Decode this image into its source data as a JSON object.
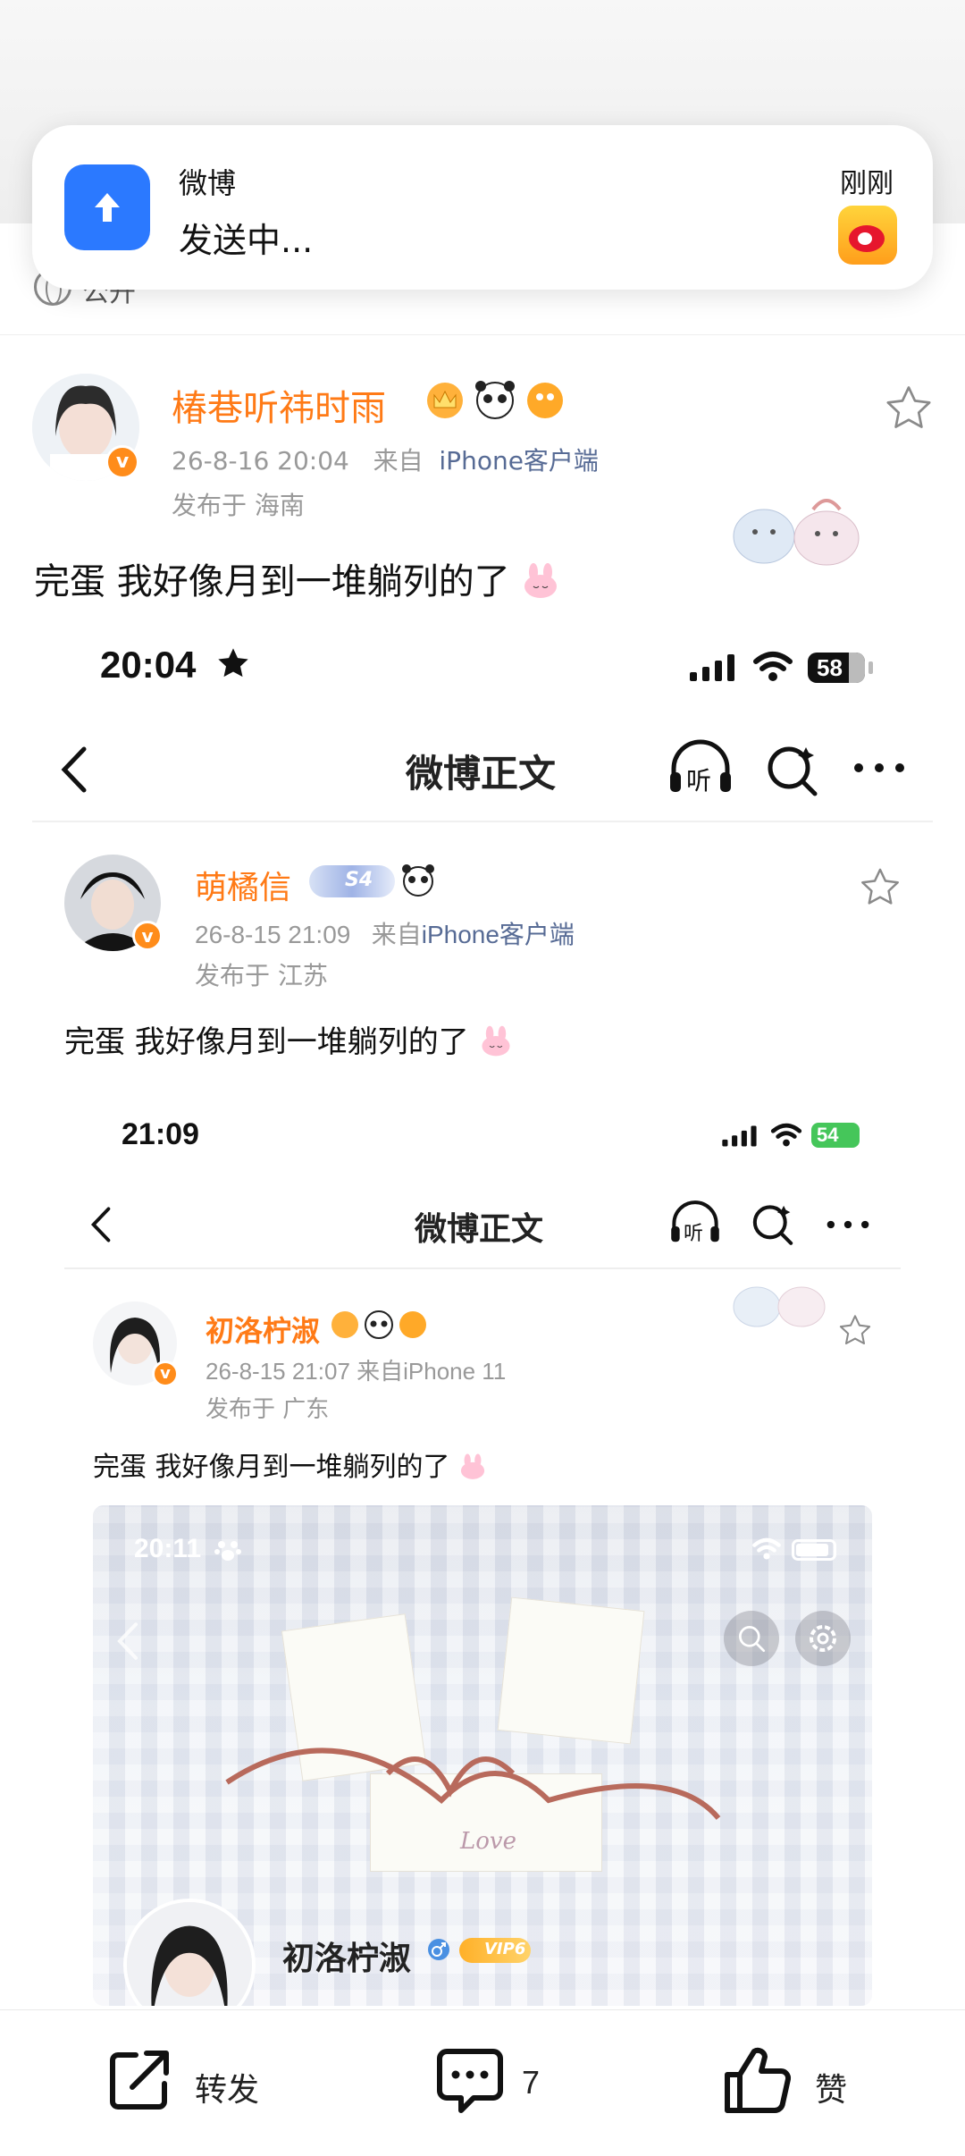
{
  "notification": {
    "app_name": "微博",
    "message": "发送中...",
    "time": "刚刚"
  },
  "visibility": {
    "label": "公开"
  },
  "post": {
    "author": "椿巷听祎时雨",
    "timestamp": "26-8-16 20:04",
    "source_prefix": "来自",
    "source": "iPhone客户端",
    "location": "发布于 海南",
    "text": "完蛋 我好像月到一堆躺列的了"
  },
  "screenshot1": {
    "status_time": "20:04",
    "battery": "58",
    "nav_title": "微博正文",
    "listen_label": "听",
    "author": "萌橘信",
    "badge_level": "S4",
    "timestamp": "26-8-15 21:09",
    "source_prefix": "来自",
    "source": "iPhone客户端",
    "location": "发布于 江苏",
    "text": "完蛋 我好像月到一堆躺列的了"
  },
  "screenshot2": {
    "status_time": "21:09",
    "battery": "54",
    "nav_title": "微博正文",
    "listen_label": "听",
    "author": "初洛柠淑",
    "meta": "26-8-15 21:07  来自iPhone 11",
    "location": "发布于 广东",
    "text": "完蛋 我好像月到一堆躺列的了"
  },
  "inner_image": {
    "status_time": "20:11",
    "profile_name": "初洛柠淑",
    "vip_label": "VIP6",
    "paper_text": "Love"
  },
  "bottom_bar": {
    "repost_label": "转发",
    "comment_count": "7",
    "like_label": "赞"
  },
  "colors": {
    "accent_orange": "#ff7a16",
    "link_blue": "#576b95",
    "notification_blue": "#2b79ff"
  }
}
